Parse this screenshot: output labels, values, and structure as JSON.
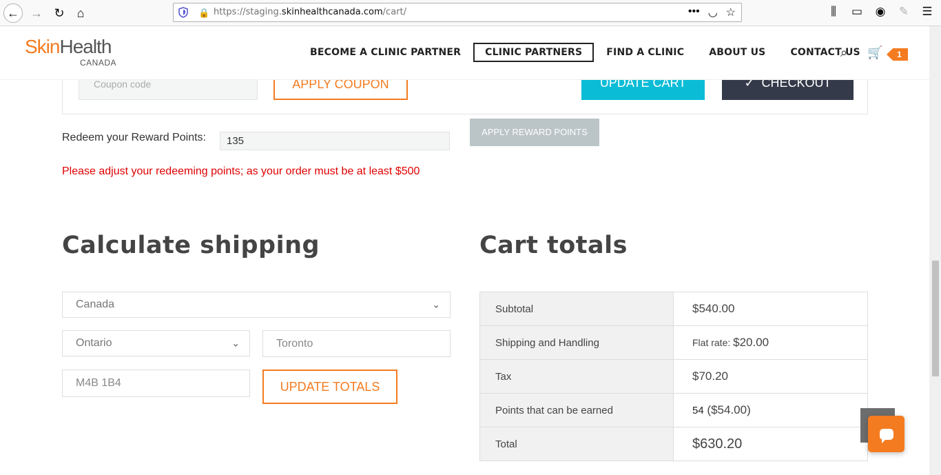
{
  "browser": {
    "url_prefix": "https://staging.",
    "url_domain": "skinhealthcanada.com",
    "url_path": "/cart/"
  },
  "header": {
    "logo_skin": "Skin",
    "logo_health": "Health",
    "logo_sub": "CANADA",
    "nav": [
      "BECOME A CLINIC PARTNER",
      "CLINIC PARTNERS",
      "FIND A CLINIC",
      "ABOUT US",
      "CONTACT US"
    ],
    "cart_count": "1"
  },
  "coupon": {
    "placeholder": "Coupon code",
    "apply_label": "APPLY COUPON",
    "update_cart_label": "UPDATE CART",
    "checkout_label": "CHECKOUT"
  },
  "reward": {
    "label": "Redeem your Reward Points:",
    "value": "135",
    "apply_label": "APPLY REWARD POINTS",
    "error": "Please adjust your redeeming points; as your order must be at least $500"
  },
  "shipping": {
    "title": "Calculate shipping",
    "country": "Canada",
    "province": "Ontario",
    "city": "Toronto",
    "postal": "M4B 1B4",
    "update_label": "UPDATE TOTALS"
  },
  "totals": {
    "title": "Cart totals",
    "rows": [
      {
        "label": "Subtotal",
        "value": "$540.00"
      },
      {
        "label": "Shipping and Handling",
        "prefix": "Flat rate: ",
        "value": "$20.00"
      },
      {
        "label": "Tax",
        "value": "$70.20"
      },
      {
        "label": "Points that can be earned",
        "points": "54",
        "value": "($54.00)"
      },
      {
        "label": "Total",
        "value": "$630.20"
      }
    ]
  },
  "colors": {
    "accent": "#f47b20",
    "update_cart": "#0bbcd6",
    "checkout": "#353a4a",
    "error": "#e00000"
  }
}
